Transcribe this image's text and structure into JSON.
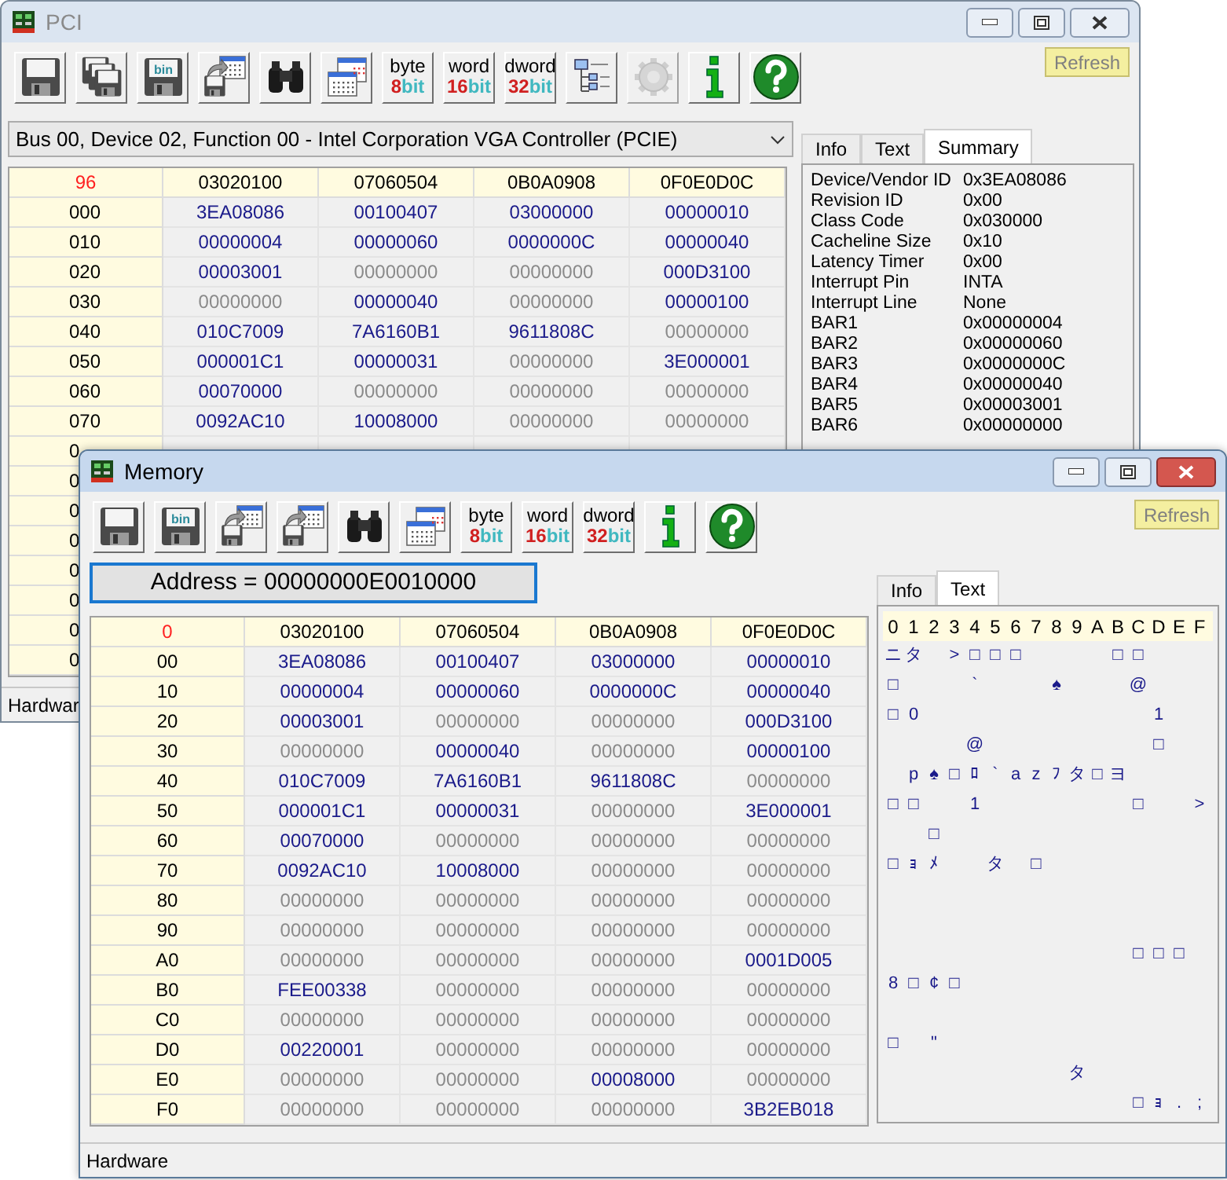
{
  "pci_window": {
    "title": "PCI",
    "active": false,
    "toolbar": [
      {
        "kind": "save",
        "disabled": false
      },
      {
        "kind": "save_all",
        "disabled": false
      },
      {
        "kind": "save_bin",
        "label": "bin",
        "disabled": false
      },
      {
        "kind": "export",
        "disabled": false
      },
      {
        "kind": "find",
        "disabled": false
      },
      {
        "kind": "windows",
        "disabled": false
      },
      {
        "kind": "width",
        "label": "byte",
        "bits": "8",
        "unit": "bit",
        "disabled": false
      },
      {
        "kind": "width",
        "label": "word",
        "bits": "16",
        "unit": "bit",
        "disabled": false
      },
      {
        "kind": "width",
        "label": "dword",
        "bits": "32",
        "unit": "bit",
        "disabled": false
      },
      {
        "kind": "tree",
        "disabled": false
      },
      {
        "kind": "gear",
        "disabled": true
      },
      {
        "kind": "info",
        "disabled": false
      },
      {
        "kind": "help",
        "disabled": false
      }
    ],
    "refresh_button": "Refresh",
    "device_select": {
      "value": "Bus 00, Device 02, Function 00 - Intel Corporation VGA Controller (PCIE)"
    },
    "tabs": [
      {
        "label": "Info",
        "selected": false
      },
      {
        "label": "Text",
        "selected": false
      },
      {
        "label": "Summary",
        "selected": true
      }
    ],
    "summary": [
      {
        "label": "Device/Vendor ID",
        "value": "0x3EA08086"
      },
      {
        "label": "Revision ID",
        "value": "0x00"
      },
      {
        "label": "Class Code",
        "value": "0x030000"
      },
      {
        "label": "Cacheline Size",
        "value": "0x10"
      },
      {
        "label": "Latency Timer",
        "value": "0x00"
      },
      {
        "label": "Interrupt Pin",
        "value": "INTA"
      },
      {
        "label": "Interrupt Line",
        "value": "None"
      },
      {
        "label": "BAR1",
        "value": "0x00000004"
      },
      {
        "label": "BAR2",
        "value": "0x00000060"
      },
      {
        "label": "BAR3",
        "value": "0x0000000C"
      },
      {
        "label": "BAR4",
        "value": "0x00000040"
      },
      {
        "label": "BAR5",
        "value": "0x00003001"
      },
      {
        "label": "BAR6",
        "value": "0x00000000"
      }
    ],
    "table": {
      "corner": "96",
      "columns": [
        "03020100",
        "07060504",
        "0B0A0908",
        "0F0E0D0C"
      ],
      "rows": [
        {
          "address": "000",
          "cells": [
            {
              "value": "3EA08086",
              "dim": false
            },
            {
              "value": "00100407",
              "dim": false
            },
            {
              "value": "03000000",
              "dim": false
            },
            {
              "value": "00000010",
              "dim": false
            }
          ]
        },
        {
          "address": "010",
          "cells": [
            {
              "value": "00000004",
              "dim": false
            },
            {
              "value": "00000060",
              "dim": false
            },
            {
              "value": "0000000C",
              "dim": false
            },
            {
              "value": "00000040",
              "dim": false
            }
          ]
        },
        {
          "address": "020",
          "cells": [
            {
              "value": "00003001",
              "dim": false
            },
            {
              "value": "00000000",
              "dim": true
            },
            {
              "value": "00000000",
              "dim": true
            },
            {
              "value": "000D3100",
              "dim": false
            }
          ]
        },
        {
          "address": "030",
          "cells": [
            {
              "value": "00000000",
              "dim": true
            },
            {
              "value": "00000040",
              "dim": false
            },
            {
              "value": "00000000",
              "dim": true
            },
            {
              "value": "00000100",
              "dim": false
            }
          ]
        },
        {
          "address": "040",
          "cells": [
            {
              "value": "010C7009",
              "dim": false
            },
            {
              "value": "7A6160B1",
              "dim": false
            },
            {
              "value": "9611808C",
              "dim": false
            },
            {
              "value": "00000000",
              "dim": true
            }
          ]
        },
        {
          "address": "050",
          "cells": [
            {
              "value": "000001C1",
              "dim": false
            },
            {
              "value": "00000031",
              "dim": false
            },
            {
              "value": "00000000",
              "dim": true
            },
            {
              "value": "3E000001",
              "dim": false
            }
          ]
        },
        {
          "address": "060",
          "cells": [
            {
              "value": "00070000",
              "dim": false
            },
            {
              "value": "00000000",
              "dim": true
            },
            {
              "value": "00000000",
              "dim": true
            },
            {
              "value": "00000000",
              "dim": true
            }
          ]
        },
        {
          "address": "070",
          "cells": [
            {
              "value": "0092AC10",
              "dim": false
            },
            {
              "value": "10008000",
              "dim": false
            },
            {
              "value": "00000000",
              "dim": true
            },
            {
              "value": "00000000",
              "dim": true
            }
          ]
        },
        {
          "address": "0"
        },
        {
          "address": "0"
        },
        {
          "address": "0"
        },
        {
          "address": "0"
        },
        {
          "address": "0"
        },
        {
          "address": "0"
        },
        {
          "address": "0"
        },
        {
          "address": "0"
        }
      ]
    },
    "status_bar": "Hardwar"
  },
  "memory_window": {
    "title": "Memory",
    "active": true,
    "toolbar": [
      {
        "kind": "save",
        "disabled": false
      },
      {
        "kind": "save_bin",
        "label": "bin",
        "disabled": false
      },
      {
        "kind": "export",
        "disabled": false
      },
      {
        "kind": "export",
        "disabled": false
      },
      {
        "kind": "find",
        "disabled": false
      },
      {
        "kind": "windows",
        "disabled": false
      },
      {
        "kind": "width",
        "label": "byte",
        "bits": "8",
        "unit": "bit",
        "disabled": false
      },
      {
        "kind": "width",
        "label": "word",
        "bits": "16",
        "unit": "bit",
        "disabled": false
      },
      {
        "kind": "width",
        "label": "dword",
        "bits": "32",
        "unit": "bit",
        "disabled": false
      },
      {
        "kind": "info",
        "disabled": false
      },
      {
        "kind": "help",
        "disabled": false
      }
    ],
    "refresh_button": "Refresh",
    "address_field": {
      "value": "Address = 00000000E0010000"
    },
    "tabs": [
      {
        "label": "Info",
        "selected": false
      },
      {
        "label": "Text",
        "selected": true
      }
    ],
    "table": {
      "corner": "0",
      "columns": [
        "03020100",
        "07060504",
        "0B0A0908",
        "0F0E0D0C"
      ],
      "rows": [
        {
          "address": "00",
          "cells": [
            {
              "value": "3EA08086",
              "dim": false
            },
            {
              "value": "00100407",
              "dim": false
            },
            {
              "value": "03000000",
              "dim": false
            },
            {
              "value": "00000010",
              "dim": false
            }
          ]
        },
        {
          "address": "10",
          "cells": [
            {
              "value": "00000004",
              "dim": false
            },
            {
              "value": "00000060",
              "dim": false
            },
            {
              "value": "0000000C",
              "dim": false
            },
            {
              "value": "00000040",
              "dim": false
            }
          ]
        },
        {
          "address": "20",
          "cells": [
            {
              "value": "00003001",
              "dim": false
            },
            {
              "value": "00000000",
              "dim": true
            },
            {
              "value": "00000000",
              "dim": true
            },
            {
              "value": "000D3100",
              "dim": false
            }
          ]
        },
        {
          "address": "30",
          "cells": [
            {
              "value": "00000000",
              "dim": true
            },
            {
              "value": "00000040",
              "dim": false
            },
            {
              "value": "00000000",
              "dim": true
            },
            {
              "value": "00000100",
              "dim": false
            }
          ]
        },
        {
          "address": "40",
          "cells": [
            {
              "value": "010C7009",
              "dim": false
            },
            {
              "value": "7A6160B1",
              "dim": false
            },
            {
              "value": "9611808C",
              "dim": false
            },
            {
              "value": "00000000",
              "dim": true
            }
          ]
        },
        {
          "address": "50",
          "cells": [
            {
              "value": "000001C1",
              "dim": false
            },
            {
              "value": "00000031",
              "dim": false
            },
            {
              "value": "00000000",
              "dim": true
            },
            {
              "value": "3E000001",
              "dim": false
            }
          ]
        },
        {
          "address": "60",
          "cells": [
            {
              "value": "00070000",
              "dim": false
            },
            {
              "value": "00000000",
              "dim": true
            },
            {
              "value": "00000000",
              "dim": true
            },
            {
              "value": "00000000",
              "dim": true
            }
          ]
        },
        {
          "address": "70",
          "cells": [
            {
              "value": "0092AC10",
              "dim": false
            },
            {
              "value": "10008000",
              "dim": false
            },
            {
              "value": "00000000",
              "dim": true
            },
            {
              "value": "00000000",
              "dim": true
            }
          ]
        },
        {
          "address": "80",
          "cells": [
            {
              "value": "00000000",
              "dim": true
            },
            {
              "value": "00000000",
              "dim": true
            },
            {
              "value": "00000000",
              "dim": true
            },
            {
              "value": "00000000",
              "dim": true
            }
          ]
        },
        {
          "address": "90",
          "cells": [
            {
              "value": "00000000",
              "dim": true
            },
            {
              "value": "00000000",
              "dim": true
            },
            {
              "value": "00000000",
              "dim": true
            },
            {
              "value": "00000000",
              "dim": true
            }
          ]
        },
        {
          "address": "A0",
          "cells": [
            {
              "value": "00000000",
              "dim": true
            },
            {
              "value": "00000000",
              "dim": true
            },
            {
              "value": "00000000",
              "dim": true
            },
            {
              "value": "0001D005",
              "dim": false
            }
          ]
        },
        {
          "address": "B0",
          "cells": [
            {
              "value": "FEE00338",
              "dim": false
            },
            {
              "value": "00000000",
              "dim": true
            },
            {
              "value": "00000000",
              "dim": true
            },
            {
              "value": "00000000",
              "dim": true
            }
          ]
        },
        {
          "address": "C0",
          "cells": [
            {
              "value": "00000000",
              "dim": true
            },
            {
              "value": "00000000",
              "dim": true
            },
            {
              "value": "00000000",
              "dim": true
            },
            {
              "value": "00000000",
              "dim": true
            }
          ]
        },
        {
          "address": "D0",
          "cells": [
            {
              "value": "00220001",
              "dim": false
            },
            {
              "value": "00000000",
              "dim": true
            },
            {
              "value": "00000000",
              "dim": true
            },
            {
              "value": "00000000",
              "dim": true
            }
          ]
        },
        {
          "address": "E0",
          "cells": [
            {
              "value": "00000000",
              "dim": true
            },
            {
              "value": "00000000",
              "dim": true
            },
            {
              "value": "00008000",
              "dim": false
            },
            {
              "value": "00000000",
              "dim": true
            }
          ]
        },
        {
          "address": "F0",
          "cells": [
            {
              "value": "00000000",
              "dim": true
            },
            {
              "value": "00000000",
              "dim": true
            },
            {
              "value": "00000000",
              "dim": true
            },
            {
              "value": "3B2EB018",
              "dim": false
            }
          ]
        }
      ]
    },
    "text_view": {
      "columns": [
        "0",
        "1",
        "2",
        "3",
        "4",
        "5",
        "6",
        "7",
        "8",
        "9",
        "A",
        "B",
        "C",
        "D",
        "E",
        "F"
      ],
      "lines": [
        {
          "cells": [
            {
              "kind": "char",
              "char": "ニ"
            },
            {
              "kind": "char",
              "char": "タ"
            },
            {
              "kind": "blank"
            },
            {
              "kind": "char",
              "char": ">"
            },
            {
              "kind": "char",
              "char": "□"
            },
            {
              "kind": "char",
              "char": "□"
            },
            {
              "kind": "char",
              "char": "□"
            },
            {
              "kind": "blank"
            },
            {
              "kind": "blank"
            },
            {
              "kind": "blank"
            },
            {
              "kind": "blank"
            },
            {
              "kind": "char",
              "char": "□"
            },
            {
              "kind": "char",
              "char": "□"
            },
            {
              "kind": "blank"
            },
            {
              "kind": "blank"
            },
            {
              "kind": "blank"
            }
          ]
        },
        {
          "cells": [
            {
              "kind": "char",
              "char": "□"
            },
            {
              "kind": "blank"
            },
            {
              "kind": "blank"
            },
            {
              "kind": "blank"
            },
            {
              "kind": "char",
              "char": "`"
            },
            {
              "kind": "blank"
            },
            {
              "kind": "blank"
            },
            {
              "kind": "blank"
            },
            {
              "kind": "char",
              "char": "♠"
            },
            {
              "kind": "blank"
            },
            {
              "kind": "blank"
            },
            {
              "kind": "blank"
            },
            {
              "kind": "char",
              "char": "@"
            },
            {
              "kind": "blank"
            },
            {
              "kind": "blank"
            },
            {
              "kind": "blank"
            }
          ]
        },
        {
          "cells": [
            {
              "kind": "char",
              "char": "□"
            },
            {
              "kind": "char",
              "char": "0"
            },
            {
              "kind": "blank"
            },
            {
              "kind": "blank"
            },
            {
              "kind": "blank"
            },
            {
              "kind": "blank"
            },
            {
              "kind": "blank"
            },
            {
              "kind": "blank"
            },
            {
              "kind": "blank"
            },
            {
              "kind": "blank"
            },
            {
              "kind": "blank"
            },
            {
              "kind": "blank"
            },
            {
              "kind": "blank"
            },
            {
              "kind": "char",
              "char": "1"
            },
            {
              "kind": "blank"
            },
            {
              "kind": "blank"
            }
          ]
        },
        {
          "cells": [
            {
              "kind": "blank"
            },
            {
              "kind": "blank"
            },
            {
              "kind": "blank"
            },
            {
              "kind": "blank"
            },
            {
              "kind": "char",
              "char": "@"
            },
            {
              "kind": "blank"
            },
            {
              "kind": "blank"
            },
            {
              "kind": "blank"
            },
            {
              "kind": "blank"
            },
            {
              "kind": "blank"
            },
            {
              "kind": "blank"
            },
            {
              "kind": "blank"
            },
            {
              "kind": "blank"
            },
            {
              "kind": "char",
              "char": "□"
            },
            {
              "kind": "blank"
            },
            {
              "kind": "blank"
            }
          ]
        },
        {
          "cells": [
            {
              "kind": "blank"
            },
            {
              "kind": "char",
              "char": "p"
            },
            {
              "kind": "char",
              "char": "♠"
            },
            {
              "kind": "char",
              "char": "□"
            },
            {
              "kind": "char",
              "char": "ﾛ"
            },
            {
              "kind": "char",
              "char": "`"
            },
            {
              "kind": "char",
              "char": "a"
            },
            {
              "kind": "char",
              "char": "z"
            },
            {
              "kind": "char",
              "char": "ﾌ"
            },
            {
              "kind": "char",
              "char": "タ"
            },
            {
              "kind": "char",
              "char": "□"
            },
            {
              "kind": "char",
              "char": "ヨ"
            },
            {
              "kind": "blank"
            },
            {
              "kind": "blank"
            },
            {
              "kind": "blank"
            },
            {
              "kind": "blank"
            }
          ]
        },
        {
          "cells": [
            {
              "kind": "char",
              "char": "□"
            },
            {
              "kind": "char",
              "char": "□"
            },
            {
              "kind": "blank"
            },
            {
              "kind": "blank"
            },
            {
              "kind": "char",
              "char": "1"
            },
            {
              "kind": "blank"
            },
            {
              "kind": "blank"
            },
            {
              "kind": "blank"
            },
            {
              "kind": "blank"
            },
            {
              "kind": "blank"
            },
            {
              "kind": "blank"
            },
            {
              "kind": "blank"
            },
            {
              "kind": "char",
              "char": "□"
            },
            {
              "kind": "blank"
            },
            {
              "kind": "blank"
            },
            {
              "kind": "char",
              "char": ">"
            }
          ]
        },
        {
          "cells": [
            {
              "kind": "blank"
            },
            {
              "kind": "blank"
            },
            {
              "kind": "char",
              "char": "□"
            },
            {
              "kind": "blank"
            },
            {
              "kind": "blank"
            },
            {
              "kind": "blank"
            },
            {
              "kind": "blank"
            },
            {
              "kind": "blank"
            },
            {
              "kind": "blank"
            },
            {
              "kind": "blank"
            },
            {
              "kind": "blank"
            },
            {
              "kind": "blank"
            },
            {
              "kind": "blank"
            },
            {
              "kind": "blank"
            },
            {
              "kind": "blank"
            },
            {
              "kind": "blank"
            }
          ]
        },
        {
          "cells": [
            {
              "kind": "char",
              "char": "□"
            },
            {
              "kind": "char",
              "char": "ｮ"
            },
            {
              "kind": "char",
              "char": "ﾒ"
            },
            {
              "kind": "blank"
            },
            {
              "kind": "blank"
            },
            {
              "kind": "char",
              "char": "タ"
            },
            {
              "kind": "blank"
            },
            {
              "kind": "char",
              "char": "□"
            },
            {
              "kind": "blank"
            },
            {
              "kind": "blank"
            },
            {
              "kind": "blank"
            },
            {
              "kind": "blank"
            },
            {
              "kind": "blank"
            },
            {
              "kind": "blank"
            },
            {
              "kind": "blank"
            },
            {
              "kind": "blank"
            }
          ]
        },
        {
          "cells": [
            {
              "kind": "blank"
            },
            {
              "kind": "blank"
            },
            {
              "kind": "blank"
            },
            {
              "kind": "blank"
            },
            {
              "kind": "blank"
            },
            {
              "kind": "blank"
            },
            {
              "kind": "blank"
            },
            {
              "kind": "blank"
            },
            {
              "kind": "blank"
            },
            {
              "kind": "blank"
            },
            {
              "kind": "blank"
            },
            {
              "kind": "blank"
            },
            {
              "kind": "blank"
            },
            {
              "kind": "blank"
            },
            {
              "kind": "blank"
            },
            {
              "kind": "blank"
            }
          ]
        },
        {
          "cells": [
            {
              "kind": "blank"
            },
            {
              "kind": "blank"
            },
            {
              "kind": "blank"
            },
            {
              "kind": "blank"
            },
            {
              "kind": "blank"
            },
            {
              "kind": "blank"
            },
            {
              "kind": "blank"
            },
            {
              "kind": "blank"
            },
            {
              "kind": "blank"
            },
            {
              "kind": "blank"
            },
            {
              "kind": "blank"
            },
            {
              "kind": "blank"
            },
            {
              "kind": "blank"
            },
            {
              "kind": "blank"
            },
            {
              "kind": "blank"
            },
            {
              "kind": "blank"
            }
          ]
        },
        {
          "cells": [
            {
              "kind": "blank"
            },
            {
              "kind": "blank"
            },
            {
              "kind": "blank"
            },
            {
              "kind": "blank"
            },
            {
              "kind": "blank"
            },
            {
              "kind": "blank"
            },
            {
              "kind": "blank"
            },
            {
              "kind": "blank"
            },
            {
              "kind": "blank"
            },
            {
              "kind": "blank"
            },
            {
              "kind": "blank"
            },
            {
              "kind": "blank"
            },
            {
              "kind": "char",
              "char": "□"
            },
            {
              "kind": "char",
              "char": "□"
            },
            {
              "kind": "char",
              "char": "□"
            },
            {
              "kind": "blank"
            }
          ]
        },
        {
          "cells": [
            {
              "kind": "char",
              "char": "8"
            },
            {
              "kind": "char",
              "char": "□"
            },
            {
              "kind": "char",
              "char": "¢"
            },
            {
              "kind": "char",
              "char": "□"
            },
            {
              "kind": "blank"
            },
            {
              "kind": "blank"
            },
            {
              "kind": "blank"
            },
            {
              "kind": "blank"
            },
            {
              "kind": "blank"
            },
            {
              "kind": "blank"
            },
            {
              "kind": "blank"
            },
            {
              "kind": "blank"
            },
            {
              "kind": "blank"
            },
            {
              "kind": "blank"
            },
            {
              "kind": "blank"
            },
            {
              "kind": "blank"
            }
          ]
        },
        {
          "cells": [
            {
              "kind": "blank"
            },
            {
              "kind": "blank"
            },
            {
              "kind": "blank"
            },
            {
              "kind": "blank"
            },
            {
              "kind": "blank"
            },
            {
              "kind": "blank"
            },
            {
              "kind": "blank"
            },
            {
              "kind": "blank"
            },
            {
              "kind": "blank"
            },
            {
              "kind": "blank"
            },
            {
              "kind": "blank"
            },
            {
              "kind": "blank"
            },
            {
              "kind": "blank"
            },
            {
              "kind": "blank"
            },
            {
              "kind": "blank"
            },
            {
              "kind": "blank"
            }
          ]
        },
        {
          "cells": [
            {
              "kind": "char",
              "char": "□"
            },
            {
              "kind": "blank"
            },
            {
              "kind": "char",
              "char": "\""
            },
            {
              "kind": "blank"
            },
            {
              "kind": "blank"
            },
            {
              "kind": "blank"
            },
            {
              "kind": "blank"
            },
            {
              "kind": "blank"
            },
            {
              "kind": "blank"
            },
            {
              "kind": "blank"
            },
            {
              "kind": "blank"
            },
            {
              "kind": "blank"
            },
            {
              "kind": "blank"
            },
            {
              "kind": "blank"
            },
            {
              "kind": "blank"
            },
            {
              "kind": "blank"
            }
          ]
        },
        {
          "cells": [
            {
              "kind": "blank"
            },
            {
              "kind": "blank"
            },
            {
              "kind": "blank"
            },
            {
              "kind": "blank"
            },
            {
              "kind": "blank"
            },
            {
              "kind": "blank"
            },
            {
              "kind": "blank"
            },
            {
              "kind": "blank"
            },
            {
              "kind": "blank"
            },
            {
              "kind": "char",
              "char": "タ"
            },
            {
              "kind": "blank"
            },
            {
              "kind": "blank"
            },
            {
              "kind": "blank"
            },
            {
              "kind": "blank"
            },
            {
              "kind": "blank"
            },
            {
              "kind": "blank"
            }
          ]
        },
        {
          "cells": [
            {
              "kind": "blank"
            },
            {
              "kind": "blank"
            },
            {
              "kind": "blank"
            },
            {
              "kind": "blank"
            },
            {
              "kind": "blank"
            },
            {
              "kind": "blank"
            },
            {
              "kind": "blank"
            },
            {
              "kind": "blank"
            },
            {
              "kind": "blank"
            },
            {
              "kind": "blank"
            },
            {
              "kind": "blank"
            },
            {
              "kind": "blank"
            },
            {
              "kind": "char",
              "char": "□"
            },
            {
              "kind": "char",
              "char": "ｮ"
            },
            {
              "kind": "char",
              "char": "."
            },
            {
              "kind": "char",
              "char": ";"
            }
          ]
        }
      ]
    },
    "status_bar": "Hardware"
  }
}
